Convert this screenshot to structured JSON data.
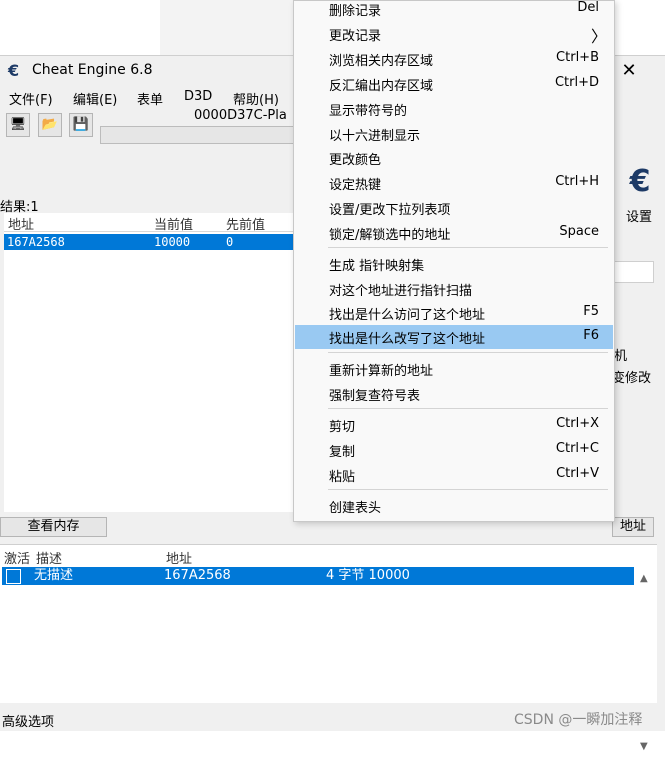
{
  "window": {
    "title": "Cheat Engine 6.8",
    "close_glyph": "✕",
    "app_icon_glyph": "€"
  },
  "menubar": {
    "items": [
      "文件(F)",
      "编辑(E)",
      "表单",
      "D3D",
      "帮助(H)"
    ]
  },
  "toolbar": {
    "process": "0000D37C-Pla",
    "open_glyph": "🖥",
    "folder_glyph": "📂",
    "save_glyph": "💾"
  },
  "results": {
    "count_label": "结果:1",
    "headers": [
      "地址",
      "当前值",
      "先前值"
    ],
    "rows": [
      {
        "address": "167A2568",
        "current": "10000",
        "previous": "0"
      }
    ]
  },
  "buttons": {
    "view_memory": "查看内存",
    "add_address": "地址"
  },
  "settings": {
    "label": "设置",
    "logo_glyph": "€"
  },
  "right_panel": {
    "text1": "机",
    "text2": "变修改"
  },
  "address_table": {
    "headers": [
      "激活",
      "描述",
      "地址"
    ],
    "row": {
      "description": "无描述",
      "address": "167A2568",
      "extra": "4 字节   10000"
    },
    "scroll_up": "▲",
    "scroll_down": "▼"
  },
  "status_bar": {
    "advanced": "高级选项",
    "watermark": "CSDN @一瞬加注释"
  },
  "context_menu": {
    "items": [
      {
        "label": "删除记录",
        "shortcut": "Del"
      },
      {
        "label": "更改记录",
        "shortcut": "",
        "arrow": "〉"
      },
      {
        "label": "浏览相关内存区域",
        "shortcut": "Ctrl+B"
      },
      {
        "label": "反汇编出内存区域",
        "shortcut": "Ctrl+D"
      },
      {
        "label": "显示带符号的",
        "shortcut": ""
      },
      {
        "label": "以十六进制显示",
        "shortcut": ""
      },
      {
        "label": "更改颜色",
        "shortcut": ""
      },
      {
        "label": "设定热键",
        "shortcut": "Ctrl+H"
      },
      {
        "label": "设置/更改下拉列表项",
        "shortcut": ""
      },
      {
        "label": "锁定/解锁选中的地址",
        "shortcut": "Space"
      },
      {
        "label": "生成 指针映射集",
        "shortcut": ""
      },
      {
        "label": "对这个地址进行指针扫描",
        "shortcut": ""
      },
      {
        "label": "找出是什么访问了这个地址",
        "shortcut": "F5"
      },
      {
        "label": "找出是什么改写了这个地址",
        "shortcut": "F6",
        "highlighted": true
      },
      {
        "label": "重新计算新的地址",
        "shortcut": ""
      },
      {
        "label": "强制复查符号表",
        "shortcut": ""
      },
      {
        "label": "剪切",
        "shortcut": "Ctrl+X"
      },
      {
        "label": "复制",
        "shortcut": "Ctrl+C"
      },
      {
        "label": "粘贴",
        "shortcut": "Ctrl+V"
      },
      {
        "label": "创建表头",
        "shortcut": ""
      }
    ]
  }
}
